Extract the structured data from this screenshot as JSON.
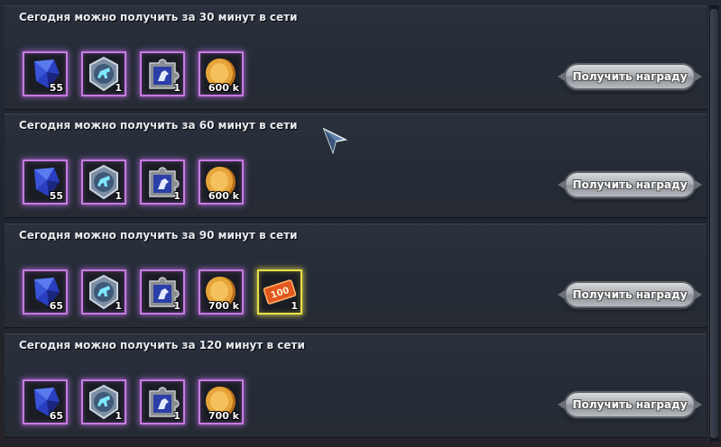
{
  "rows": [
    {
      "title": "Сегодня можно получить за 30 минут в сети",
      "button_label": "Получить награду",
      "items": [
        {
          "icon": "blue-crystal-icon",
          "qty": "55"
        },
        {
          "icon": "silver-horse-badge-icon",
          "qty": "1"
        },
        {
          "icon": "puzzle-piece-icon",
          "qty": "1"
        },
        {
          "icon": "gold-coin-icon",
          "qty": "600 k"
        }
      ]
    },
    {
      "title": "Сегодня можно получить за 60 минут в сети",
      "button_label": "Получить награду",
      "items": [
        {
          "icon": "blue-crystal-icon",
          "qty": "55"
        },
        {
          "icon": "silver-horse-badge-icon",
          "qty": "1"
        },
        {
          "icon": "puzzle-piece-icon",
          "qty": "1"
        },
        {
          "icon": "gold-coin-icon",
          "qty": "600 k"
        }
      ]
    },
    {
      "title": "Сегодня можно получить за 90 минут в сети",
      "button_label": "Получить награду",
      "items": [
        {
          "icon": "blue-crystal-icon",
          "qty": "65"
        },
        {
          "icon": "silver-horse-badge-icon",
          "qty": "1"
        },
        {
          "icon": "puzzle-piece-icon",
          "qty": "1"
        },
        {
          "icon": "gold-coin-icon",
          "qty": "700 k"
        },
        {
          "icon": "ticket-100-icon",
          "qty": "1",
          "ticket_label": "100"
        }
      ]
    },
    {
      "title": "Сегодня можно получить за 120 минут в сети",
      "button_label": "Получить награду",
      "items": [
        {
          "icon": "blue-crystal-icon",
          "qty": "65"
        },
        {
          "icon": "silver-horse-badge-icon",
          "qty": "1"
        },
        {
          "icon": "puzzle-piece-icon",
          "qty": "1"
        },
        {
          "icon": "gold-coin-icon",
          "qty": "700 k"
        }
      ]
    }
  ],
  "colors": {
    "purple_frame": "#c77be2",
    "gold_frame": "#e9df4a",
    "panel_bg": "#252c37"
  }
}
